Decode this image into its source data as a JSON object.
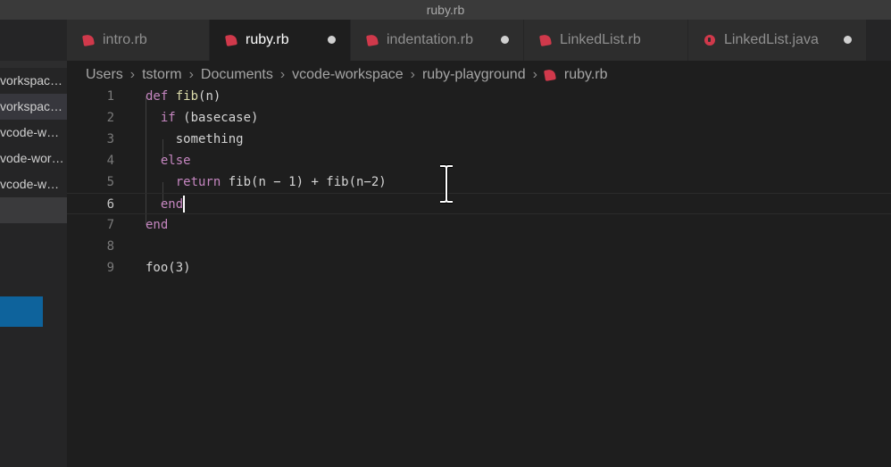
{
  "window": {
    "title": "ruby.rb"
  },
  "sidebar": {
    "items": [
      {
        "label": "vorkspac…"
      },
      {
        "label": "vorkspac…"
      },
      {
        "label": "vcode-w…"
      },
      {
        "label": "vode-wor…"
      },
      {
        "label": "vcode-w…"
      }
    ]
  },
  "tabs": [
    {
      "label": "intro.rb",
      "icon": "ruby-icon",
      "modified": false,
      "active": false
    },
    {
      "label": "ruby.rb",
      "icon": "ruby-icon",
      "modified": true,
      "active": true
    },
    {
      "label": "indentation.rb",
      "icon": "ruby-icon",
      "modified": true,
      "active": false
    },
    {
      "label": "LinkedList.rb",
      "icon": "ruby-icon",
      "modified": false,
      "active": false
    },
    {
      "label": "LinkedList.java",
      "icon": "java-icon",
      "modified": true,
      "active": false
    }
  ],
  "breadcrumb": [
    "Users",
    "tstorm",
    "Documents",
    "vcode-workspace",
    "ruby-playground",
    "ruby.rb"
  ],
  "editor": {
    "current_line": 6,
    "lines": [
      {
        "number": "1",
        "parts": [
          {
            "t": "def",
            "c": "kw"
          },
          {
            "t": " "
          },
          {
            "t": "fib",
            "c": "fn"
          },
          {
            "t": "(n)"
          }
        ]
      },
      {
        "number": "2",
        "parts": [
          {
            "t": "  "
          },
          {
            "t": "if",
            "c": "kw"
          },
          {
            "t": " (basecase)"
          }
        ]
      },
      {
        "number": "3",
        "parts": [
          {
            "t": "    something"
          }
        ]
      },
      {
        "number": "4",
        "parts": [
          {
            "t": "  "
          },
          {
            "t": "else",
            "c": "kw"
          }
        ]
      },
      {
        "number": "5",
        "parts": [
          {
            "t": "    "
          },
          {
            "t": "return",
            "c": "kw"
          },
          {
            "t": " fib(n − 1) + fib(n−2)"
          }
        ]
      },
      {
        "number": "6",
        "parts": [
          {
            "t": "  "
          },
          {
            "t": "end",
            "c": "kw"
          }
        ]
      },
      {
        "number": "7",
        "parts": [
          {
            "t": "end",
            "c": "kw"
          }
        ]
      },
      {
        "number": "8",
        "parts": []
      },
      {
        "number": "9",
        "parts": [
          {
            "t": "foo(3)"
          }
        ]
      }
    ]
  },
  "colors": {
    "accent": "#0e639c",
    "ruby_icon": "#d0394b",
    "keyword": "#c586c0"
  }
}
